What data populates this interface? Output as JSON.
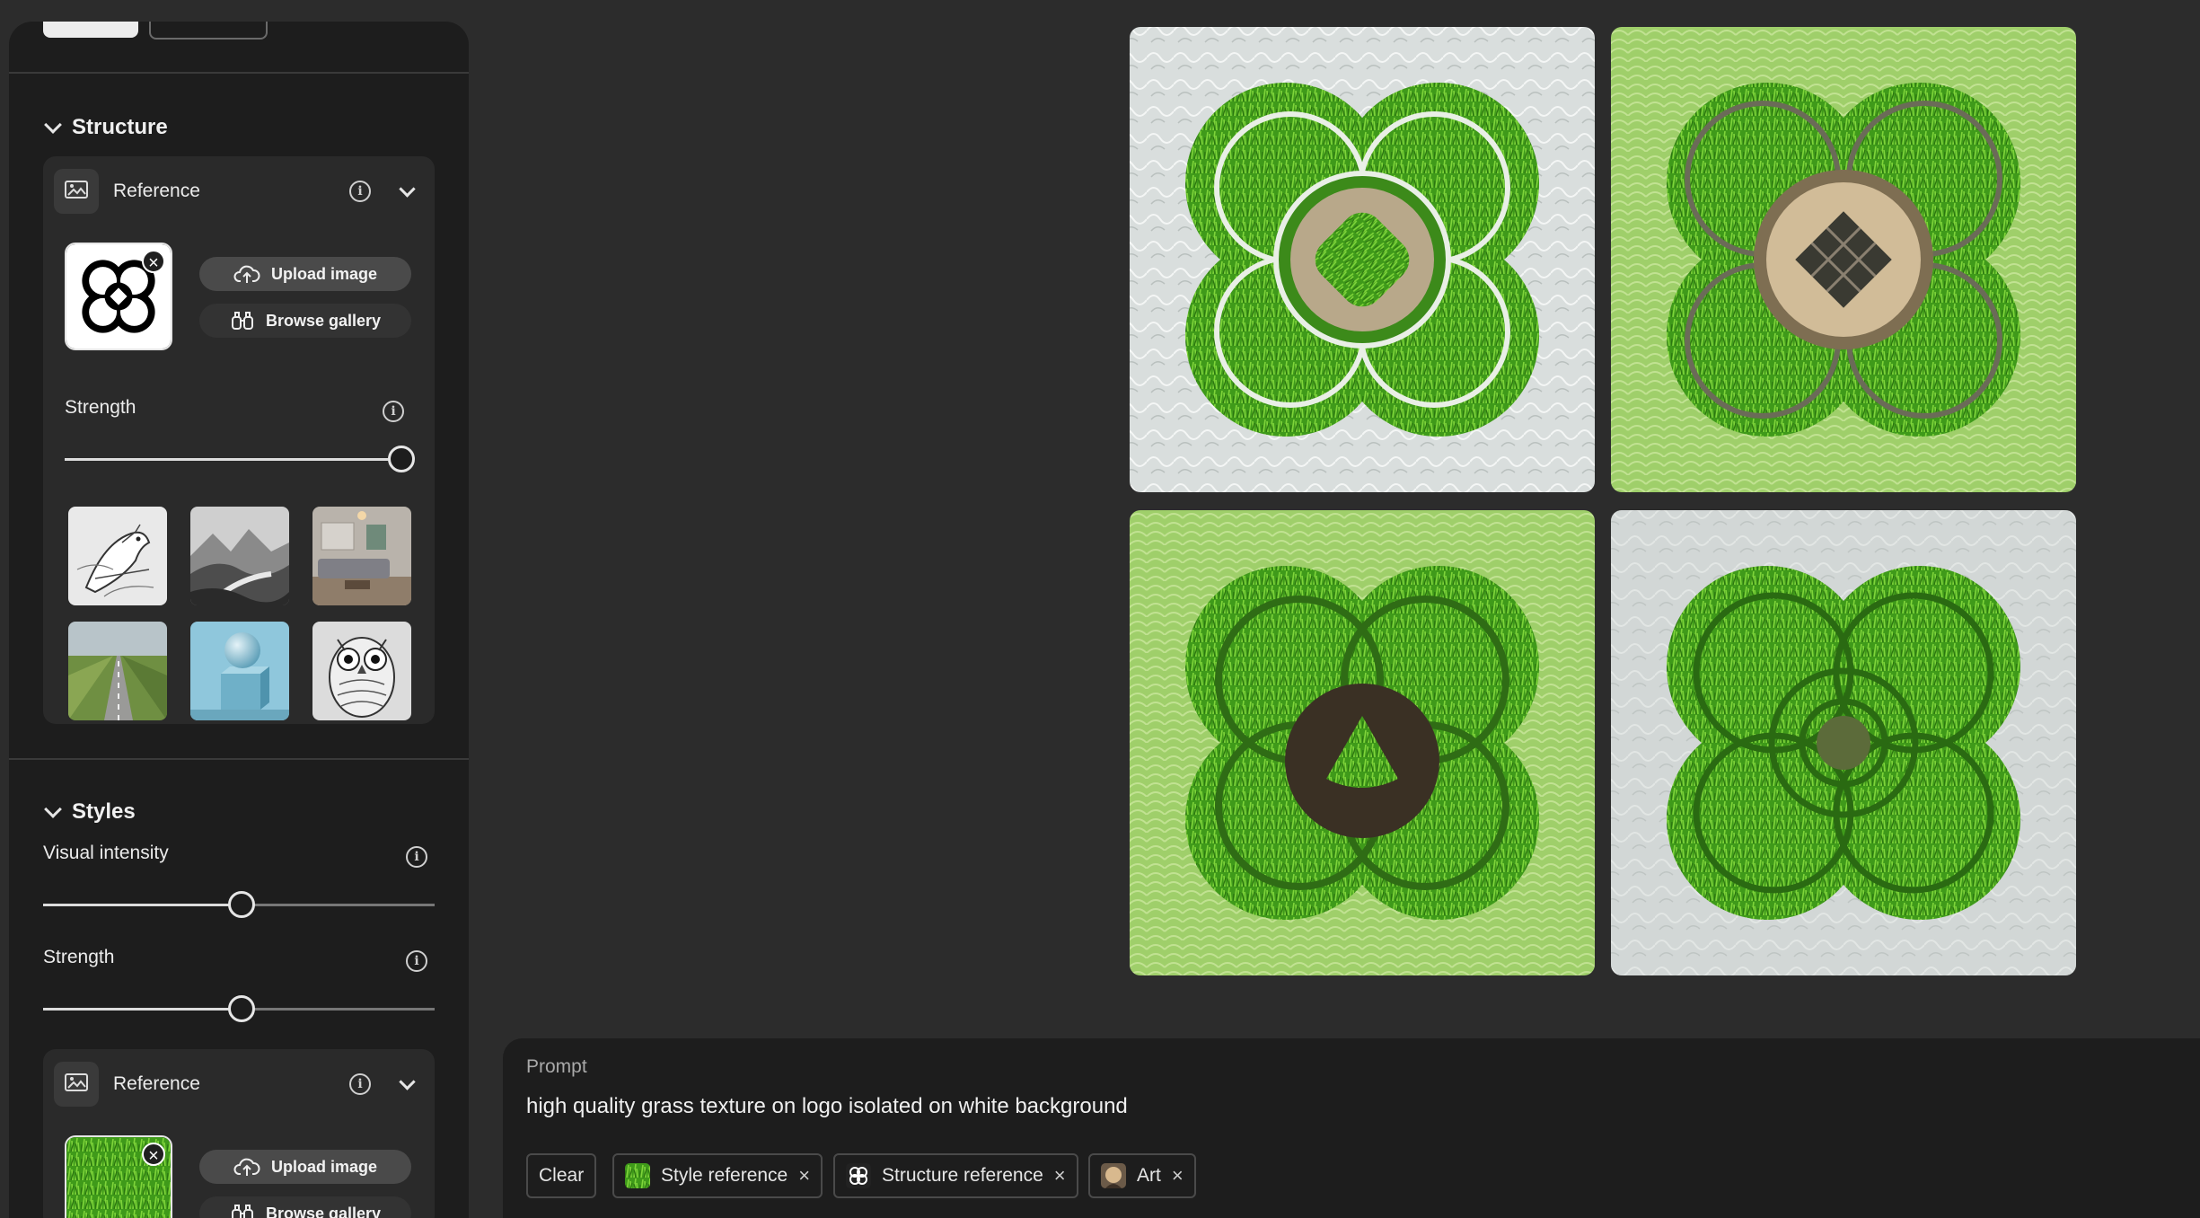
{
  "structure": {
    "title": "Structure",
    "reference": {
      "label": "Reference",
      "upload_label": "Upload image",
      "browse_label": "Browse gallery"
    },
    "strength_label": "Strength",
    "strength_value": 1.0,
    "presets": [
      "bird-sketch",
      "mountain-landscape",
      "living-room",
      "road-field",
      "sphere-on-cube",
      "owl-sketch"
    ]
  },
  "styles": {
    "title": "Styles",
    "visual_intensity_label": "Visual intensity",
    "visual_intensity_value": 0.5,
    "strength_label": "Strength",
    "strength_value": 0.5,
    "reference": {
      "label": "Reference",
      "upload_label": "Upload image",
      "browse_label": "Browse gallery"
    }
  },
  "prompt": {
    "title": "Prompt",
    "text": "high quality grass texture on logo isolated on white background",
    "clear_label": "Clear",
    "chips": [
      {
        "label": "Style reference",
        "icon": "grass-thumbnail"
      },
      {
        "label": "Structure reference",
        "icon": "logo-thumbnail"
      },
      {
        "label": "Art",
        "icon": "art-thumbnail"
      }
    ]
  },
  "colors": {
    "background": "#2c2c2c",
    "panel": "#1d1d1d",
    "card": "#2a2a2a",
    "grass": "#4caf1f"
  }
}
